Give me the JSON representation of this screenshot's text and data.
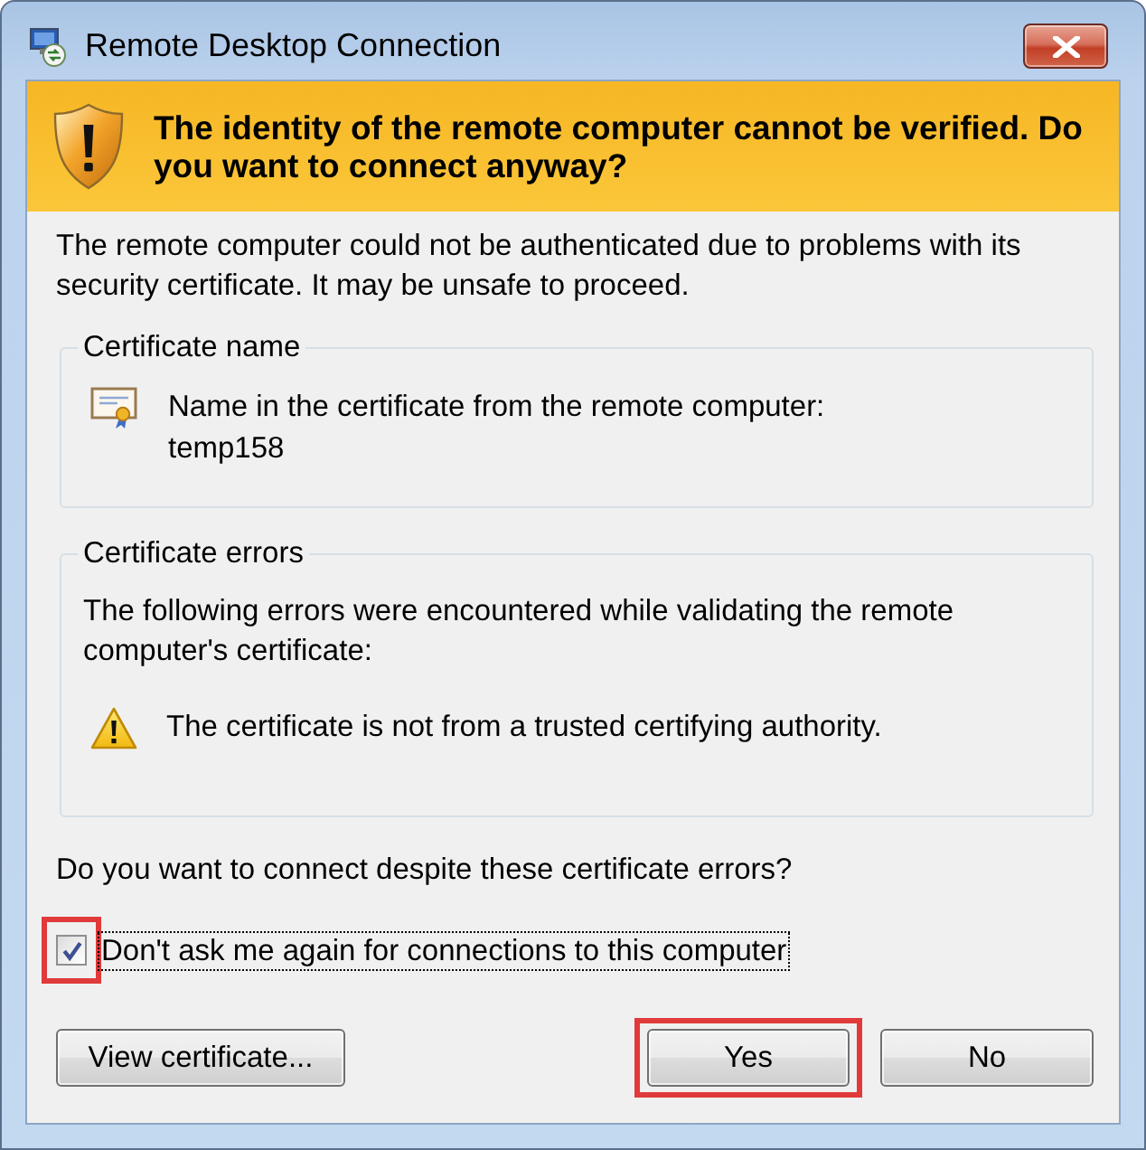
{
  "window": {
    "title": "Remote Desktop Connection"
  },
  "banner": {
    "heading": "The identity of the remote computer cannot be verified. Do you want to connect anyway?"
  },
  "description": "The remote computer could not be authenticated due to problems with its security certificate. It may be unsafe to proceed.",
  "groups": [
    {
      "kind": "certificate_name",
      "legend": "Certificate name",
      "lines": [
        "Name in the certificate from the remote computer:",
        "temp158"
      ]
    },
    {
      "kind": "certificate_errors",
      "legend": "Certificate errors",
      "intro": "The following errors were encountered while validating the remote computer's certificate:",
      "errors": [
        "The certificate is not from a trusted certifying authority."
      ]
    }
  ],
  "question": "Do you want to connect despite these certificate errors?",
  "checkbox": {
    "label": "Don't ask me again for connections to this computer",
    "checked": true,
    "focused": true,
    "highlighted": true
  },
  "buttons": [
    {
      "label": "View certificate...",
      "highlighted": false
    },
    {
      "label": "Yes",
      "highlighted": true
    },
    {
      "label": "No",
      "highlighted": false
    }
  ]
}
